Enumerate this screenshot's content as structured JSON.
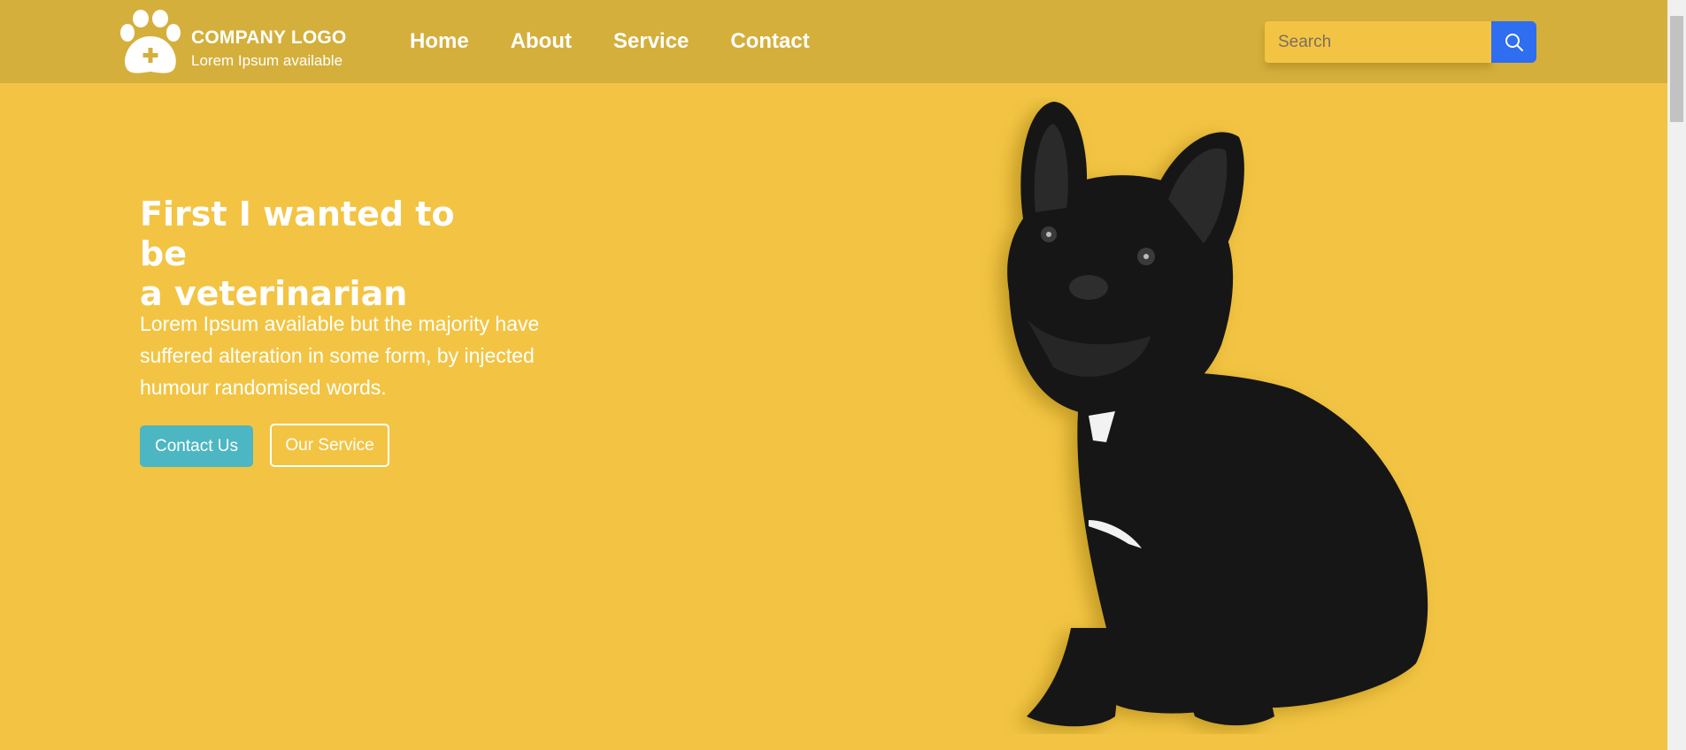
{
  "logo": {
    "title": "COMPANY LOGO",
    "subtitle": "Lorem Ipsum available",
    "icon": "paw-plus-icon"
  },
  "nav": {
    "items": [
      "Home",
      "About",
      "Service",
      "Contact"
    ]
  },
  "search": {
    "placeholder": "Search",
    "value": "",
    "icon": "search-icon"
  },
  "hero": {
    "title_line1": "First I wanted to be",
    "title_line2": "a veterinarian",
    "text": "Lorem Ipsum available but the majority have suffered alteration in some form, by injected humour randomised words.",
    "primary_button": "Contact Us",
    "secondary_button": "Our Service"
  },
  "colors": {
    "background": "#f3c443",
    "header": "#d4af3c",
    "search_button": "#2f6df1",
    "primary_button": "#4cb7c3"
  }
}
